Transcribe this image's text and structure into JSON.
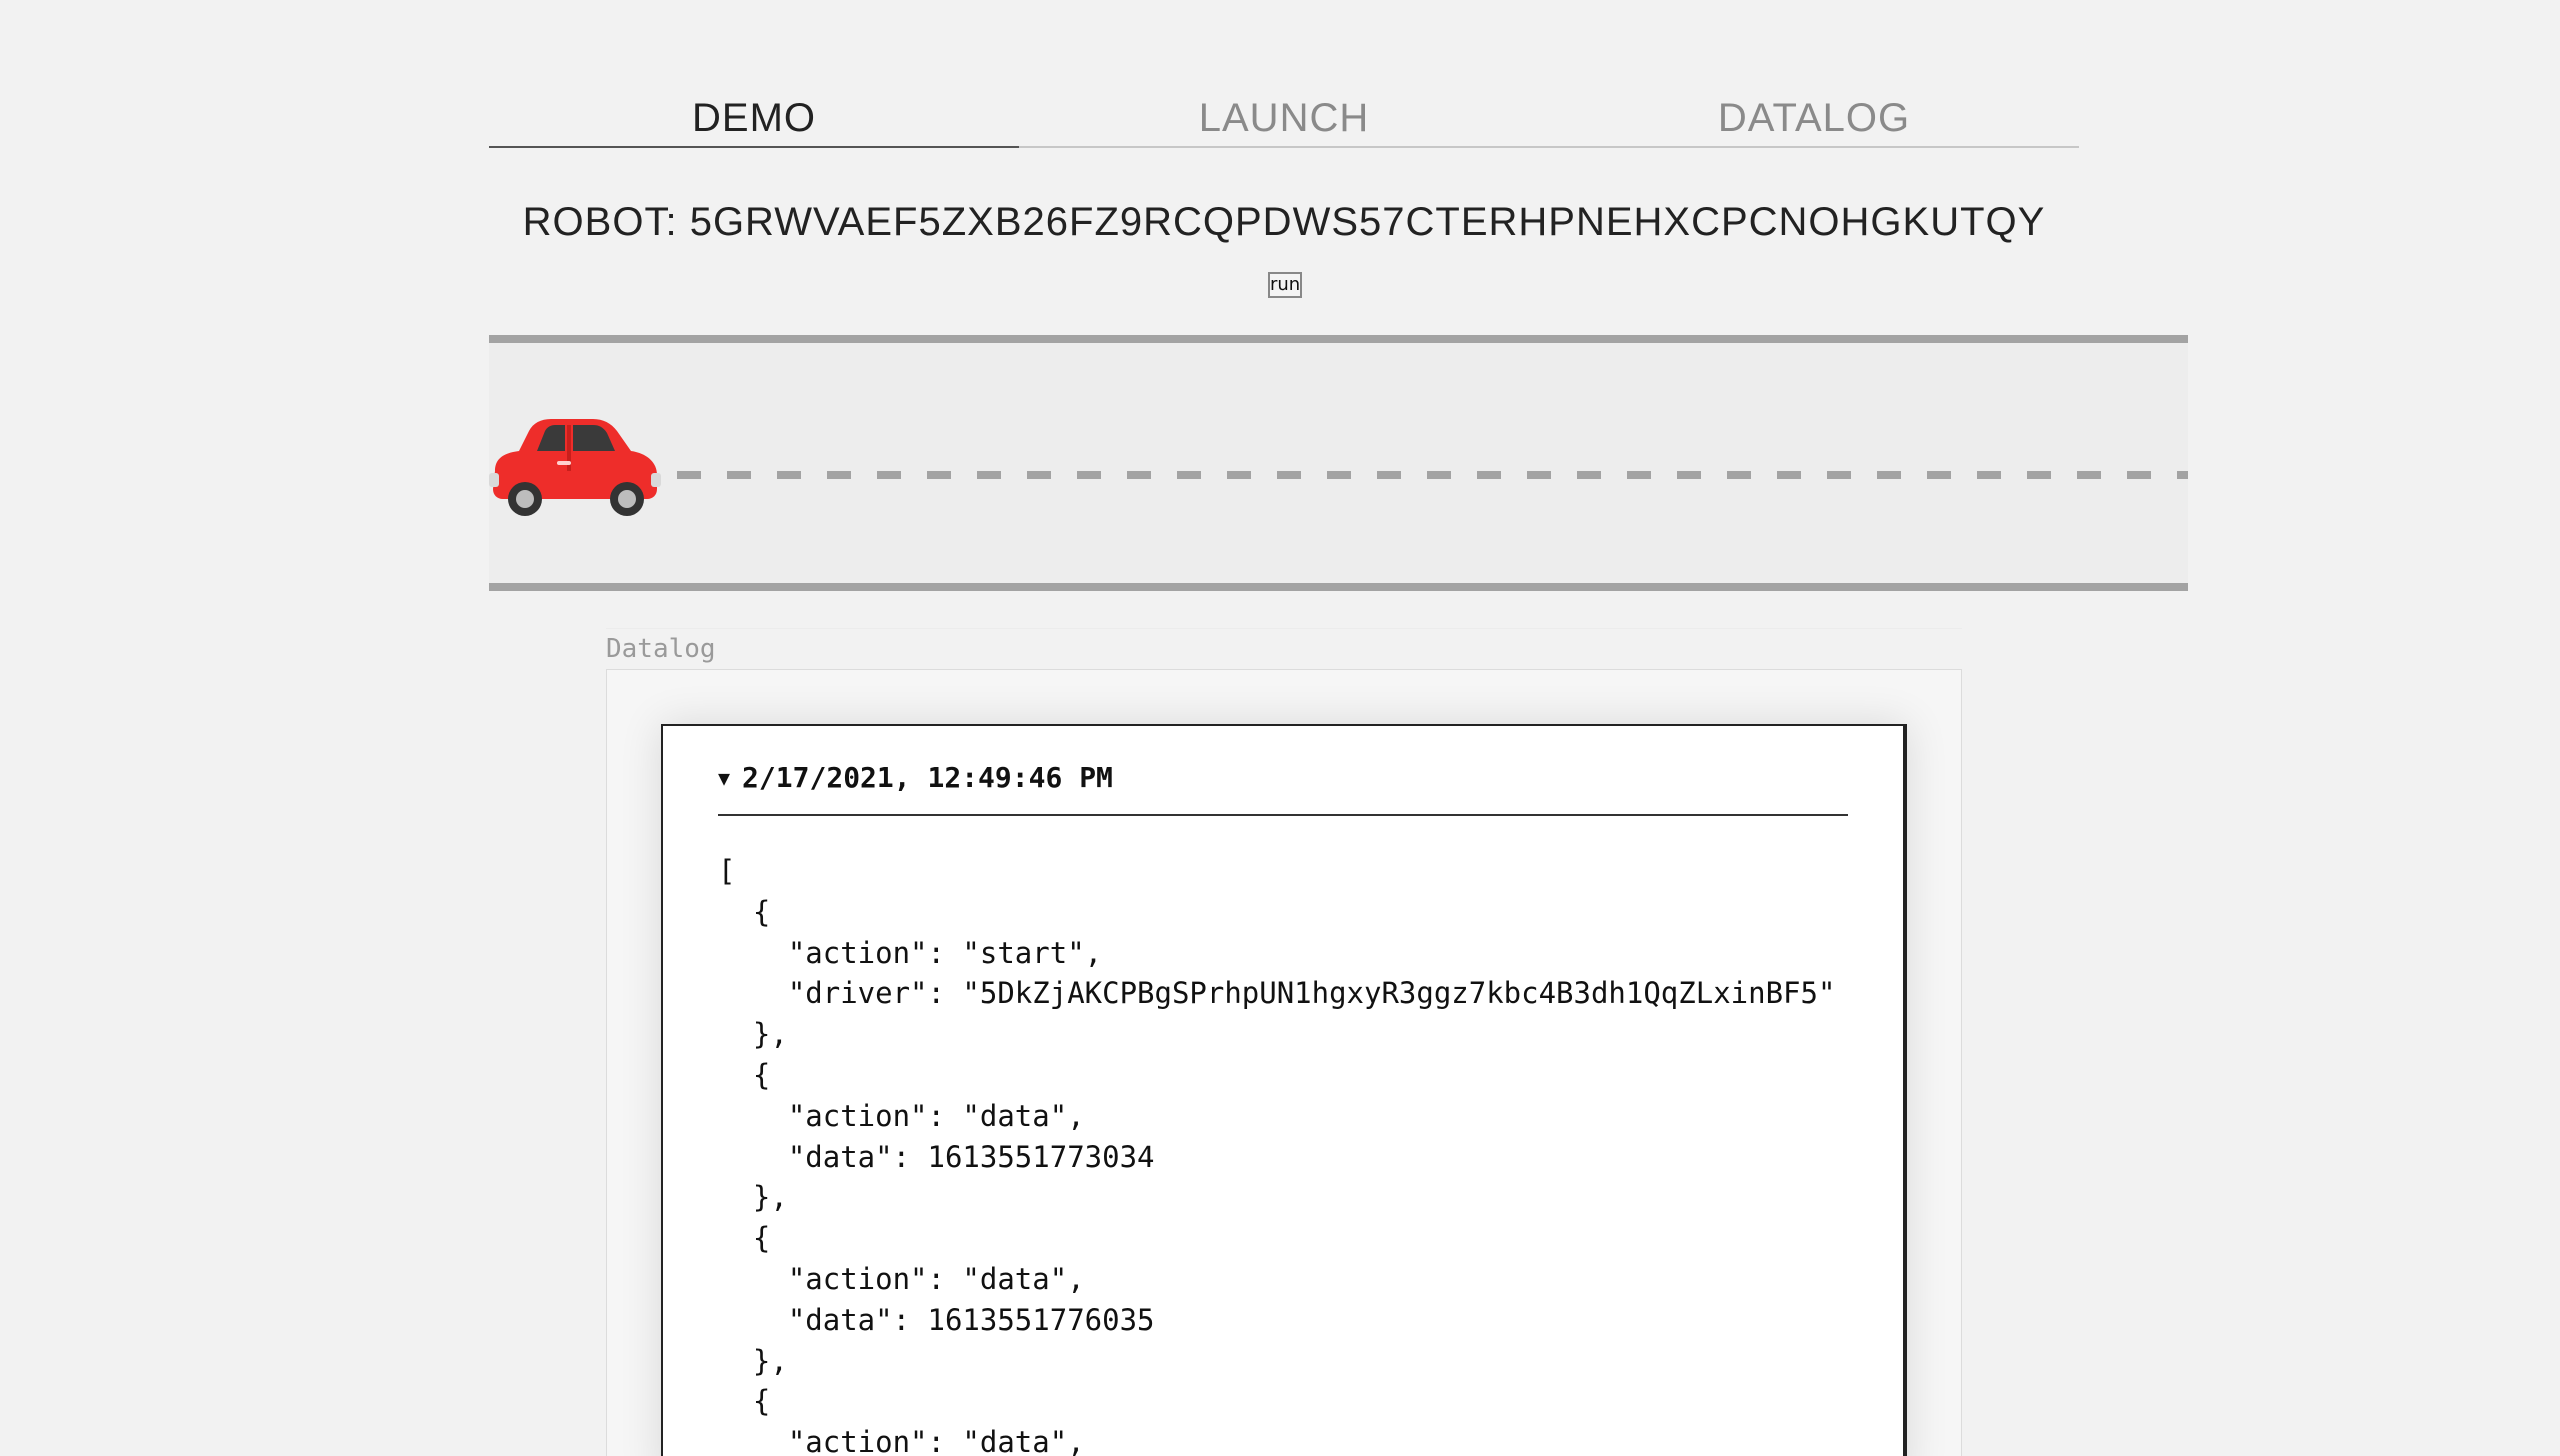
{
  "tabs": [
    {
      "label": "DEMO",
      "active": true
    },
    {
      "label": "LAUNCH",
      "active": false
    },
    {
      "label": "DATALOG",
      "active": false
    }
  ],
  "robot": {
    "label": "ROBOT: 5GRWVAEF5ZXB26FZ9RCQPDWS57CTERHPNEHXCPCNOHGKUTQY",
    "run_button": "run"
  },
  "road": {
    "car_icon": "car-icon",
    "car_color": "#ee2d2a"
  },
  "datalog": {
    "title": "Datalog",
    "entry": {
      "toggle_icon": "▼",
      "timestamp": "2/17/2021, 12:49:46 PM",
      "json": "[\n  {\n    \"action\": \"start\",\n    \"driver\": \"5DkZjAKCPBgSPrhpUN1hgxyR3ggz7kbc4B3dh1QqZLxinBF5\"\n  },\n  {\n    \"action\": \"data\",\n    \"data\": 1613551773034\n  },\n  {\n    \"action\": \"data\",\n    \"data\": 1613551776035\n  },\n  {\n    \"action\": \"data\","
    }
  }
}
